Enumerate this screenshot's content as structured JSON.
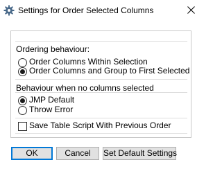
{
  "window": {
    "title": "Settings for Order Selected Columns"
  },
  "ordering": {
    "label": "Ordering behaviour:",
    "options": [
      {
        "label": "Order Columns Within Selection",
        "selected": false
      },
      {
        "label": "Order Columns and Group to First Selected",
        "selected": true
      }
    ]
  },
  "no_selection": {
    "label": "Behaviour when no columns selected",
    "options": [
      {
        "label": "JMP Default",
        "selected": true
      },
      {
        "label": "Throw Error",
        "selected": false
      }
    ]
  },
  "save_script": {
    "label": "Save Table Script With Previous Order",
    "checked": false
  },
  "buttons": {
    "ok": "OK",
    "cancel": "Cancel",
    "defaults": "Set Default Settings"
  },
  "colors": {
    "accent": "#0078d7",
    "button_face": "#e1e1e1"
  }
}
